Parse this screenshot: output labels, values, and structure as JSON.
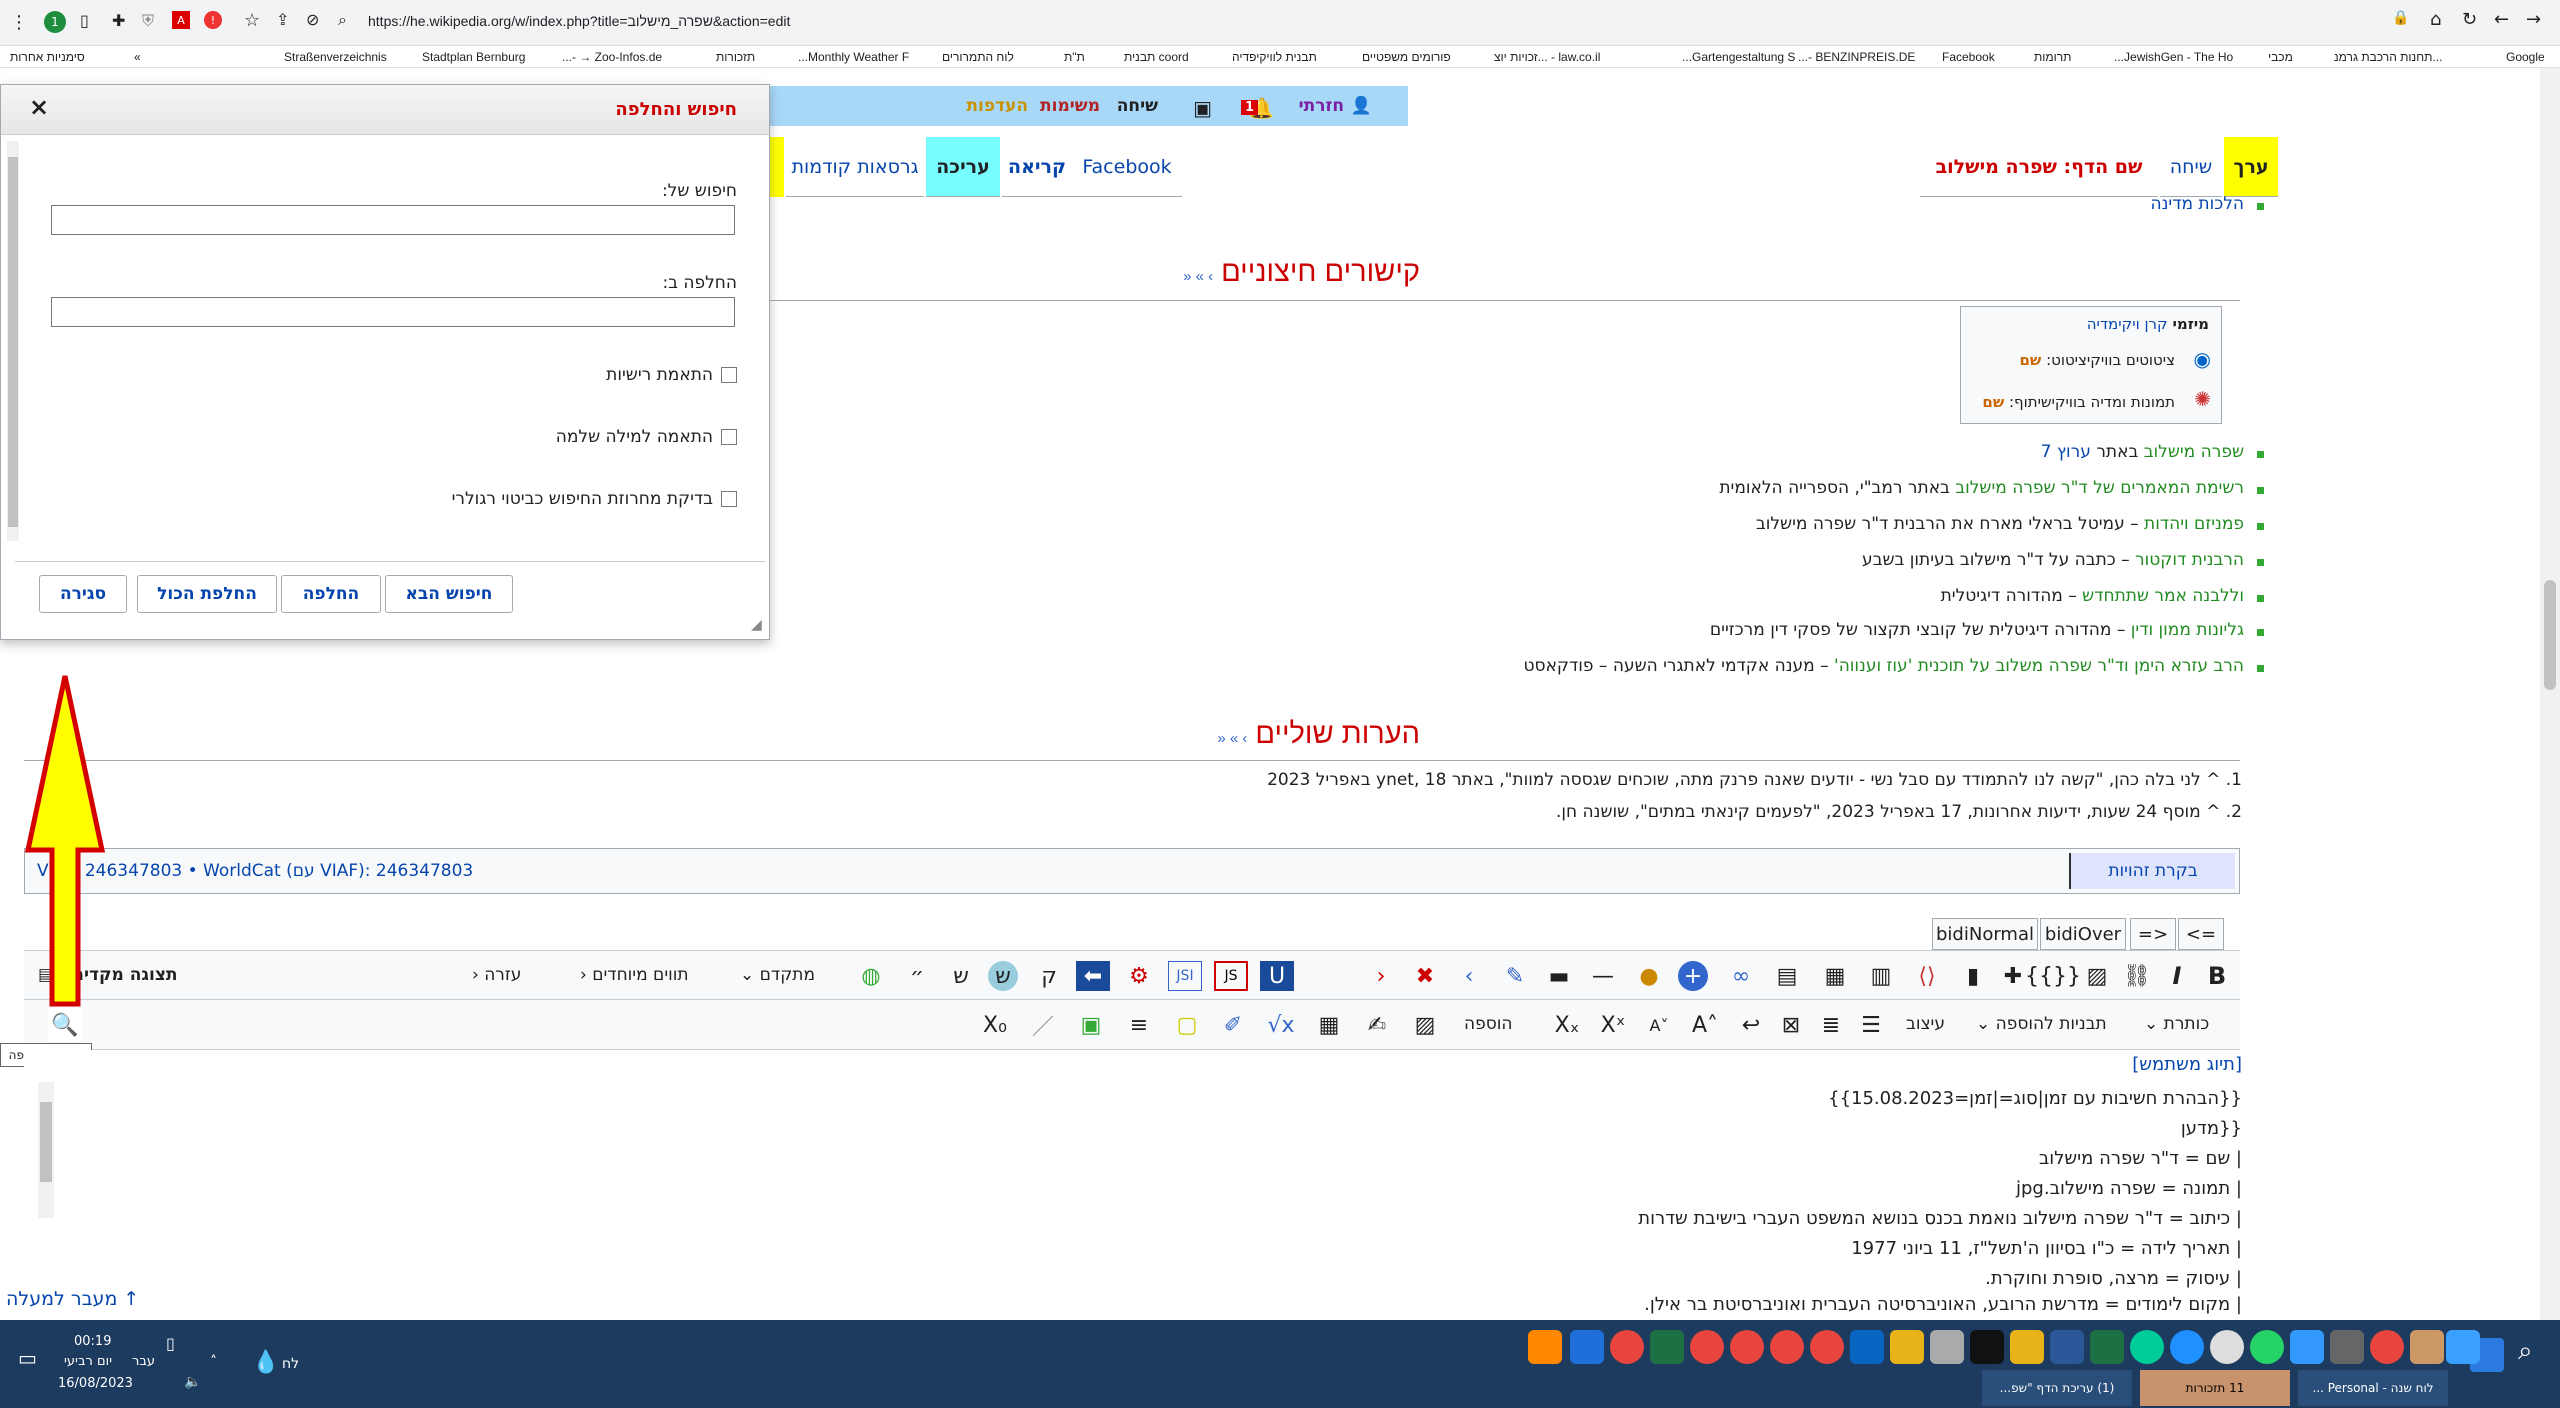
{
  "browser": {
    "url": "https://he.wikipedia.org/w/index.php?title=שפרה_מישלוב&action=edit",
    "bookmarks": [
      "סימניות אחרות",
      "Straßenverzeichnis",
      "Stadtplan Bernburg",
      "Zoo-Infos.de → -...",
      "תזכורות",
      "Monthly Weather F...",
      "לוח התמרורים",
      "ת\"ת",
      "coord תבנית",
      "תבנית לוויקיפדיה",
      "פורומים משפטיים",
      "law.co.il - ...זכויות יוצ",
      "Gartengestaltung S...",
      "BENZINPREIS.DE -...",
      "Facebook",
      "תרומות",
      "JewishGen - The Ho...",
      "מכבי",
      "...תחנות הרכבת גרמנ",
      "Google"
    ],
    "ext_badge": "1"
  },
  "userbar": {
    "user": "חזרתי",
    "notif_count": "1",
    "talk": "שיחה",
    "watchlist": "משימות",
    "prefs": "העדפות"
  },
  "tabs": {
    "edit": "ערך",
    "talk": "שיחה",
    "pagename": "שם הדף: שפרה מישלוב",
    "facebook": "Facebook",
    "read": "קריאה",
    "editing": "עריכה",
    "history": "גרסאות קודמות"
  },
  "article": {
    "prev_link": "הלכות מדינה",
    "ext_heading": "קישורים חיצוניים",
    "heading_arrows": "› » «",
    "sister_title": "קרן ויקימדיה",
    "sister_prefix": "מיזמי",
    "sister1": "ציטוטים בוויקיציטוט:",
    "sister1_link": "שם",
    "sister2": "תמונות ומדיה בוויקישיתוף:",
    "sister2_link": "שם",
    "links": [
      {
        "a": "שפרה מישלוב",
        "b": " באתר ",
        "c": "ערוץ 7"
      },
      {
        "a": "רשימת המאמרים של ד\"ר שפרה מישלוב",
        "b": " באתר רמב\"י, הספרייה הלאומית",
        "c": ""
      },
      {
        "a": "פמניזם ויהדות",
        "b": " – עמיטל בראלי מארח את הרבנית ד\"ר שפרה מישלוב",
        "c": ""
      },
      {
        "a": "הרבנית דוקטור",
        "b": " – כתבה על ד\"ר מישלוב בעיתון בשבע",
        "c": ""
      },
      {
        "a": "וללבנה אמר שתתחדש",
        "b": " – מהדורה דיגיטלית",
        "c": ""
      },
      {
        "a": "גליונות ממון ודין",
        "b": " – מהדורה דיגיטלית של קובצי תקצור של פסקי דין מרכזיים",
        "c": ""
      },
      {
        "a": "הרב עזרא הימן וד\"ר שפרה משלוב על תוכנית 'עוז וענווה'",
        "b": " – מענה אקדמי לאתגרי השעה – פודקאסט",
        "c": ""
      }
    ],
    "notes_heading": "הערות שוליים",
    "notes": [
      "1. ^ לני בלה כהן, \"קשה לנו להתמודד עם סבל נשי - יודעים שאנה פרנק מתה, שוכחים שגססה למוות\", באתר ynet, 18 באפריל 2023",
      "2. ^ מוסף 24 שעות, ידיעות אחרונות, 17 באפריל 2023, \"לפעמים קינאתי במתים\", שושנה חן."
    ],
    "authority": "VIAF: 246347803 • WorldCat (עם VIAF): 246347803",
    "authority_btn": "בקרת זהויות"
  },
  "dialog": {
    "title": "חיפוש והחלפה",
    "search_label": "חיפוש של:",
    "replace_label": "החלפה ב:",
    "opt_case": "התאמת רישיות",
    "opt_word": "התאמה למילה שלמה",
    "opt_regex": "בדיקת מחרוזת החיפוש כביטוי רגולרי",
    "btn_next": "חיפוש הבא",
    "btn_replace": "החלפה",
    "btn_replace_all": "החלפת הכול",
    "btn_close": "סגירה"
  },
  "toolbar": {
    "bidi_normal": "bidiNormal",
    "bidi_over": "bidiOver",
    "rtl_arrow": "=>",
    "ltr_arrow": "<=",
    "preview": "תצוגה מקדימה",
    "help": "עזרה",
    "special": "תווים מיוחדים",
    "advanced": "מתקדם",
    "heading": "כותרת",
    "templates": "תבניות להוספה",
    "format": "עיצוב",
    "insert": "הוספה",
    "search_tooltip": "חיפוש והחלפה"
  },
  "editor": {
    "lines": [
      "[תיוג משתמש]",
      "{{הבהרת חשיבות עם זמן|סוג=|זמן=15.08.2023}}",
      "{{מדען",
      "| שם = ד\"ר שפרה מישלוב",
      "| תמונה = שפרה מישלוב.jpg",
      "| כיתוב = ד\"ר שפרה מישלוב נואמת בכנס בנושא המשפט העברי בישיבת שדרות",
      "| תאריך לידה = כ\"ו בסיוון ה'תשל\"ז, 11 ביוני 1977",
      "| עיסוק = מרצה, סופרת וחוקרת.",
      "| מקום לימודים = מדרשת הרובע, האוניברסיטה העברית ואוניברסיטת בר אילן."
    ],
    "back_to_top": "↑ מעבר למעלה"
  },
  "taskbar": {
    "time": "00:19",
    "day": "יום רביעי",
    "lang": "עבר",
    "date": "16/08/2023",
    "weather": "לח",
    "task1": "(1) עריכת הדף \"שפ...",
    "task2": "11 תזכורות",
    "task3": "לוח שנה - Personal ..."
  },
  "colors": {
    "accent_yellow": "#ffff00",
    "userbar": "#a8d8f8",
    "edit_tab": "#7ff",
    "red_heading": "#cc0000"
  }
}
